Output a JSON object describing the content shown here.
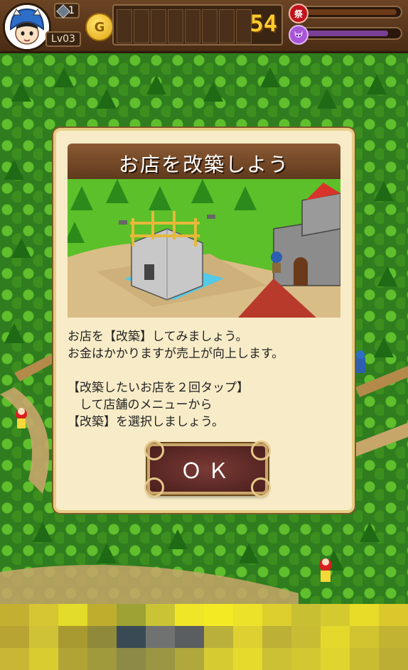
{
  "hud": {
    "level": "Lv03",
    "item_count": "1",
    "gold": "54",
    "festival_label": "祭",
    "coin_letter": "G"
  },
  "dialog": {
    "title": "お店を改築しよう",
    "lines": [
      "お店を【改築】してみましょう。",
      "お金はかかりますが売上が向上します。",
      "",
      "【改築したいお店を２回タップ】",
      "　して店舗のメニューから",
      "【改築】を選択しましょう。"
    ],
    "ok_label": "ＯＫ"
  },
  "colors": {
    "hud_brown": "#4a2c14",
    "dialog_bg": "#f8ecc8",
    "title_bar": "#6b4424",
    "gold_text": "#ffcc2e",
    "forest_green": "#2f7d1e"
  }
}
